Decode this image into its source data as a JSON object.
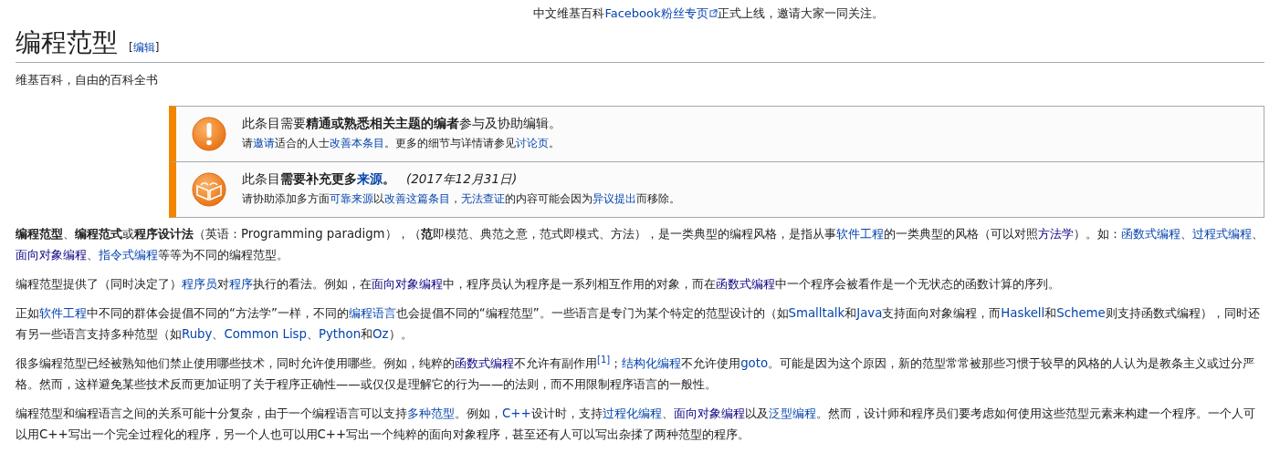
{
  "site_notice": [
    {
      "text": "中文维基百科",
      "kind": "plain"
    },
    {
      "text": "Facebook粉丝专页",
      "kind": "external"
    },
    {
      "text": "正式上线，邀请大家一同关注。",
      "kind": "plain"
    }
  ],
  "title": "编程范型",
  "edit_section": [
    {
      "text": "[",
      "kind": "plain"
    },
    {
      "text": "编辑",
      "kind": "link"
    },
    {
      "text": "]",
      "kind": "plain"
    }
  ],
  "tagline": "维基百科，自由的百科全书",
  "notices": [
    {
      "kind": "warning",
      "lines": [
        [
          {
            "text": "此条目需要",
            "kind": "plain"
          },
          {
            "text": "精通或熟悉相关主题的编者",
            "kind": "bold"
          },
          {
            "text": "参与及协助编辑。",
            "kind": "plain"
          }
        ],
        [
          {
            "text": "请",
            "kind": "plain"
          },
          {
            "text": "邀请",
            "kind": "link"
          },
          {
            "text": "适合的人士",
            "kind": "plain"
          },
          {
            "text": "改善本条目",
            "kind": "link"
          },
          {
            "text": "。更多的细节与详情请参见",
            "kind": "plain"
          },
          {
            "text": "讨论页",
            "kind": "link"
          },
          {
            "text": "。",
            "kind": "plain"
          }
        ]
      ]
    },
    {
      "kind": "book",
      "lines": [
        [
          {
            "text": "此条目",
            "kind": "plain"
          },
          {
            "text": "需要补充更多",
            "kind": "bold"
          },
          {
            "text": "来源",
            "kind": "bold-link"
          },
          {
            "text": "。",
            "kind": "bold"
          },
          {
            "text": "(2017年12月31日)",
            "kind": "italic"
          }
        ],
        [
          {
            "text": "请协助添加多方面",
            "kind": "plain"
          },
          {
            "text": "可靠来源",
            "kind": "link"
          },
          {
            "text": "以",
            "kind": "plain"
          },
          {
            "text": "改善这篇条目",
            "kind": "link"
          },
          {
            "text": "，",
            "kind": "plain"
          },
          {
            "text": "无法查证",
            "kind": "link"
          },
          {
            "text": "的内容可能会因为",
            "kind": "plain"
          },
          {
            "text": "异议提出",
            "kind": "link"
          },
          {
            "text": "而移除。",
            "kind": "plain"
          }
        ]
      ]
    }
  ],
  "paragraphs": [
    [
      {
        "text": "编程范型",
        "kind": "bold"
      },
      {
        "text": "、",
        "kind": "plain"
      },
      {
        "text": "编程范式",
        "kind": "bold"
      },
      {
        "text": "或",
        "kind": "plain"
      },
      {
        "text": "程序设计法",
        "kind": "bold"
      },
      {
        "text": "（英语：Programming paradigm），（",
        "kind": "plain"
      },
      {
        "text": "范",
        "kind": "bold"
      },
      {
        "text": "即模范、典范之意，范式即模式、方法），是一类典型的编程风格，是指从事",
        "kind": "plain"
      },
      {
        "text": "软件工程",
        "kind": "link"
      },
      {
        "text": "的一类典型的风格（可以对照",
        "kind": "plain"
      },
      {
        "text": "方法学",
        "kind": "visited"
      },
      {
        "text": "）。如：",
        "kind": "plain"
      },
      {
        "text": "函数式编程",
        "kind": "link"
      },
      {
        "text": "、",
        "kind": "plain"
      },
      {
        "text": "过程式编程",
        "kind": "link"
      },
      {
        "text": "、",
        "kind": "plain"
      },
      {
        "text": "面向对象编程",
        "kind": "visited"
      },
      {
        "text": "、",
        "kind": "plain"
      },
      {
        "text": "指令式编程",
        "kind": "link"
      },
      {
        "text": "等等为不同的编程范型。",
        "kind": "plain"
      }
    ],
    [
      {
        "text": "编程范型提供了（同时决定了）",
        "kind": "plain"
      },
      {
        "text": "程序员",
        "kind": "link"
      },
      {
        "text": "对",
        "kind": "plain"
      },
      {
        "text": "程序",
        "kind": "link"
      },
      {
        "text": "执行的看法。例如，在",
        "kind": "plain"
      },
      {
        "text": "面向对象编程",
        "kind": "visited"
      },
      {
        "text": "中，程序员认为程序是一系列相互作用的对象，而在",
        "kind": "plain"
      },
      {
        "text": "函数式编程",
        "kind": "visited"
      },
      {
        "text": "中一个程序会被看作是一个无状态的函数计算的序列。",
        "kind": "plain"
      }
    ],
    [
      {
        "text": "正如",
        "kind": "plain"
      },
      {
        "text": "软件工程",
        "kind": "link"
      },
      {
        "text": "中不同的群体会提倡不同的“方法学”一样，不同的",
        "kind": "plain"
      },
      {
        "text": "编程语言",
        "kind": "link"
      },
      {
        "text": "也会提倡不同的“编程范型”。一些语言是专门为某个特定的范型设计的（如",
        "kind": "plain"
      },
      {
        "text": "Smalltalk",
        "kind": "link"
      },
      {
        "text": "和",
        "kind": "plain"
      },
      {
        "text": "Java",
        "kind": "link"
      },
      {
        "text": "支持面向对象编程，而",
        "kind": "plain"
      },
      {
        "text": "Haskell",
        "kind": "link"
      },
      {
        "text": "和",
        "kind": "plain"
      },
      {
        "text": "Scheme",
        "kind": "link"
      },
      {
        "text": "则支持函数式编程），同时还有另一些语言支持多种范型（如",
        "kind": "plain"
      },
      {
        "text": "Ruby",
        "kind": "link"
      },
      {
        "text": "、",
        "kind": "plain"
      },
      {
        "text": "Common Lisp",
        "kind": "link"
      },
      {
        "text": "、",
        "kind": "plain"
      },
      {
        "text": "Python",
        "kind": "link"
      },
      {
        "text": "和",
        "kind": "plain"
      },
      {
        "text": "Oz",
        "kind": "link"
      },
      {
        "text": "）。",
        "kind": "plain"
      }
    ],
    [
      {
        "text": "很多编程范型已经被熟知他们禁止使用哪些技术，同时允许使用哪些。例如，纯粹的",
        "kind": "plain"
      },
      {
        "text": "函数式编程",
        "kind": "visited"
      },
      {
        "text": "不允许有副作用",
        "kind": "plain"
      },
      {
        "text": "[1]",
        "kind": "ref"
      },
      {
        "text": "；",
        "kind": "plain"
      },
      {
        "text": "结构化编程",
        "kind": "link"
      },
      {
        "text": "不允许使用",
        "kind": "plain"
      },
      {
        "text": "goto",
        "kind": "link"
      },
      {
        "text": "。可能是因为这个原因，新的范型常常被那些习惯于较早的风格的人认为是教条主义或过分严格。然而，这样避免某些技术反而更加证明了关于程序正确性——或仅仅是理解它的行为——的法则，而不用限制程序语言的一般性。",
        "kind": "plain"
      }
    ],
    [
      {
        "text": "编程范型和编程语言之间的关系可能十分复杂，由于一个编程语言可以支持",
        "kind": "plain"
      },
      {
        "text": "多种范型",
        "kind": "link"
      },
      {
        "text": "。例如，",
        "kind": "plain"
      },
      {
        "text": "C++",
        "kind": "link"
      },
      {
        "text": "设计时，支持",
        "kind": "plain"
      },
      {
        "text": "过程化编程",
        "kind": "link"
      },
      {
        "text": "、",
        "kind": "plain"
      },
      {
        "text": "面向对象编程",
        "kind": "visited"
      },
      {
        "text": "以及",
        "kind": "plain"
      },
      {
        "text": "泛型编程",
        "kind": "link"
      },
      {
        "text": "。然而，设计师和程序员们要考虑如何使用这些范型元素来构建一个程序。一个人可以用C++写出一个完全过程化的程序，另一个人也可以用C++写出一个纯粹的面向对象程序，甚至还有人可以写出杂揉了两种范型的程序。",
        "kind": "plain"
      }
    ]
  ]
}
